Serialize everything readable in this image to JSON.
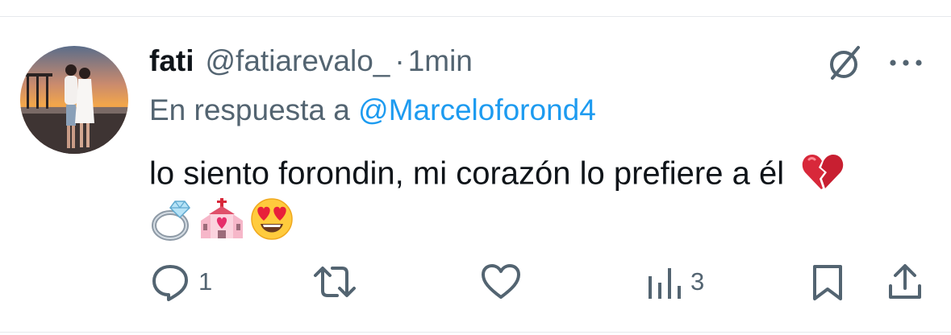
{
  "tweet": {
    "display_name": "fati",
    "handle": "@fatiarevalo_",
    "separator": "·",
    "time": "1min",
    "reply_prefix": "En respuesta a",
    "reply_to": "@Marceloforond4",
    "text": "lo siento forondin, mi corazón lo prefiere a él",
    "emojis": [
      "broken-heart",
      "ring",
      "wedding-chapel",
      "heart-eyes-face"
    ]
  },
  "actions": {
    "reply_count": "1",
    "views_count": "3"
  },
  "icons": {
    "grok": "grok-slash-circle-icon",
    "more": "more-dots-icon",
    "reply": "reply-bubble-icon",
    "retweet": "retweet-icon",
    "like": "heart-icon",
    "views": "bar-chart-icon",
    "bookmark": "bookmark-icon",
    "share": "share-upload-icon"
  },
  "colors": {
    "text_primary": "#0f1419",
    "text_secondary": "#536471",
    "mention": "#1d9bf0"
  }
}
